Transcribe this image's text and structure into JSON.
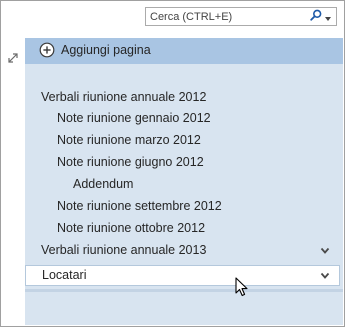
{
  "search": {
    "placeholder": "Cerca (CTRL+E)"
  },
  "page_list": {
    "add_page_label": "Aggiungi pagina",
    "items": [
      {
        "label": "Verbali riunione annuale 2012"
      },
      {
        "label": "Note riunione gennaio 2012"
      },
      {
        "label": "Note riunione marzo 2012"
      },
      {
        "label": "Note riunione giugno 2012"
      },
      {
        "label": "Addendum"
      },
      {
        "label": "Note riunione settembre 2012"
      },
      {
        "label": "Note riunione ottobre 2012"
      },
      {
        "label": "Verbali riunione annuale 2013"
      }
    ]
  },
  "section": {
    "locatari_label": "Locatari"
  },
  "colors": {
    "accent": "#1e5aa8",
    "add_page_bar": "#a9c5e3",
    "pane_bg": "#d8e4f0"
  },
  "icons": {
    "search": "magnifier-icon",
    "expand": "expand-diagonal-arrow-icon",
    "add": "circle-plus-icon",
    "chevron": "chevron-down-icon",
    "pointer": "mouse-pointer-icon"
  }
}
